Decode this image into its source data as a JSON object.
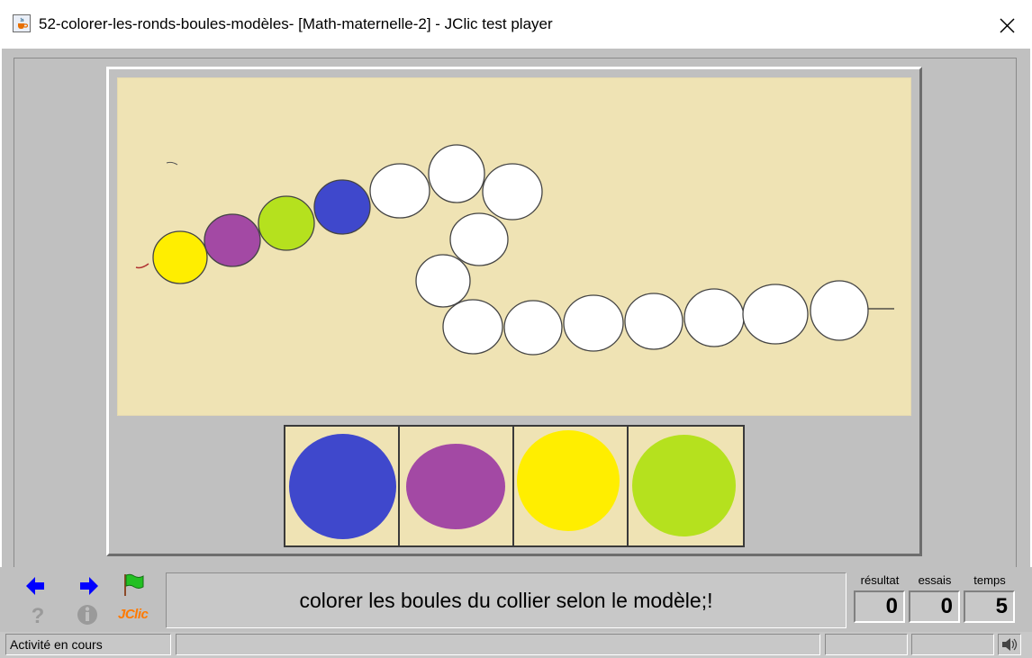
{
  "window": {
    "title": "52-colorer-les-ronds-boules-modèles- [Math-maternelle-2] - JClic test player",
    "app_icon": "java-cup-icon",
    "close_icon": "close-icon"
  },
  "activity": {
    "necklace_beads": [
      {
        "color": "#ffee00"
      },
      {
        "color": "#a349a4"
      },
      {
        "color": "#b5e11e"
      },
      {
        "color": "#3f48cc"
      },
      {
        "color": "#ffffff"
      },
      {
        "color": "#ffffff"
      },
      {
        "color": "#ffffff"
      },
      {
        "color": "#ffffff"
      },
      {
        "color": "#ffffff"
      },
      {
        "color": "#ffffff"
      },
      {
        "color": "#ffffff"
      },
      {
        "color": "#ffffff"
      },
      {
        "color": "#ffffff"
      },
      {
        "color": "#ffffff"
      },
      {
        "color": "#ffffff"
      },
      {
        "color": "#ffffff"
      }
    ],
    "palette": [
      {
        "color": "#3f48cc"
      },
      {
        "color": "#a349a4"
      },
      {
        "color": "#ffee00"
      },
      {
        "color": "#b5e11e"
      }
    ],
    "background_color": "#efe3b4"
  },
  "controls": {
    "prev_icon": "arrow-left-icon",
    "next_icon": "arrow-right-icon",
    "flag_icon": "green-flag-icon",
    "help_icon": "question-icon",
    "info_icon": "info-icon",
    "jclic_logo": "JClic"
  },
  "message": "colorer les boules du collier selon le modèle;!",
  "counters": {
    "score_label": "résultat",
    "score_value": "0",
    "tries_label": "essais",
    "tries_value": "0",
    "time_label": "temps",
    "time_value": "5"
  },
  "status": {
    "text": "Activité en cours",
    "sound_icon": "speaker-icon"
  }
}
